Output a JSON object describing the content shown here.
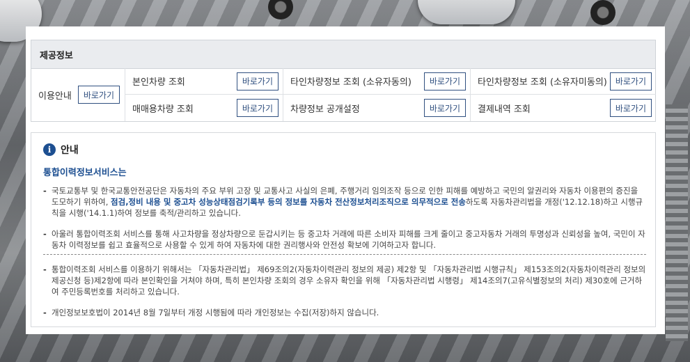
{
  "section": {
    "title": "제공정보",
    "guide": {
      "label": "이용안내",
      "button": "바로가기"
    },
    "items": [
      {
        "label": "본인차량 조회",
        "button": "바로가기"
      },
      {
        "label": "타인차량정보 조회 (소유자동의)",
        "button": "바로가기"
      },
      {
        "label": "타인차량정보 조회 (소유자미동의)",
        "button": "바로가기"
      },
      {
        "label": "매매용차량 조회",
        "button": "바로가기"
      },
      {
        "label": "차량정보 공개설정",
        "button": "바로가기"
      },
      {
        "label": "결제내역 조회",
        "button": "바로가기"
      }
    ]
  },
  "info": {
    "icon": "info-icon",
    "icon_glyph": "i",
    "title": "안내",
    "subtitle": "통합이력정보서비스는",
    "bullet": "-",
    "para1": {
      "pre": "국토교통부 및 한국교통안전공단은 자동차의 주요 부위 고장 및 교통사고 사실의 은폐, 주행거리 임의조작 등으로 인한 피해를 예방하고 국민의 알권리와 자동차 이용편의 증진을 도모하기 위하여, ",
      "strong": "점검,정비 내용 및 중고차 성능상태점검기록부 등의 정보를 자동차 전산정보처리조직으로 의무적으로 전송",
      "post": "하도록 자동차관리법을 개정('12.12.18)하고 시행규칙을 시행('14.1.1)하여 정보를 축적/관리하고 있습니다."
    },
    "para2": "아울러 통합이력조회 서비스를 통해 사고차량을 정상차량으로 둔갑시키는 등 중고차 거래에 따른 소비자 피해를 크게 줄이고 중고자동차 거래의 투명성과 신뢰성을 높여, 국민이 자동차 이력정보를 쉽고 효율적으로 사용할 수 있게 하여 자동차에 대한 권리행사와 안전성 확보에 기여하고자 합니다.",
    "para3": "통합이력조회 서비스를 이용하기 위해서는 「자동차관리법」 제69조의2(자동차이력관리 정보의 제공) 제2항 및 「자동차관리법 시행규칙」 제153조의2(자동차이력관리 정보의 제공신청 등)제2항에 따라 본인확인을 거쳐야 하며, 특히 본인차량 조회의 경우 소유자 확인을 위해 「자동차관리법 시행령」 제14조의7(고유식별정보의 처리) 제30호에 근거하여 주민등록번호를 처리하고 있습니다.",
    "para4": "개인정보보호법이 2014년 8월 7일부터 개정 시행됨에 따라 개인정보는 수집(저장)하지 않습니다."
  }
}
